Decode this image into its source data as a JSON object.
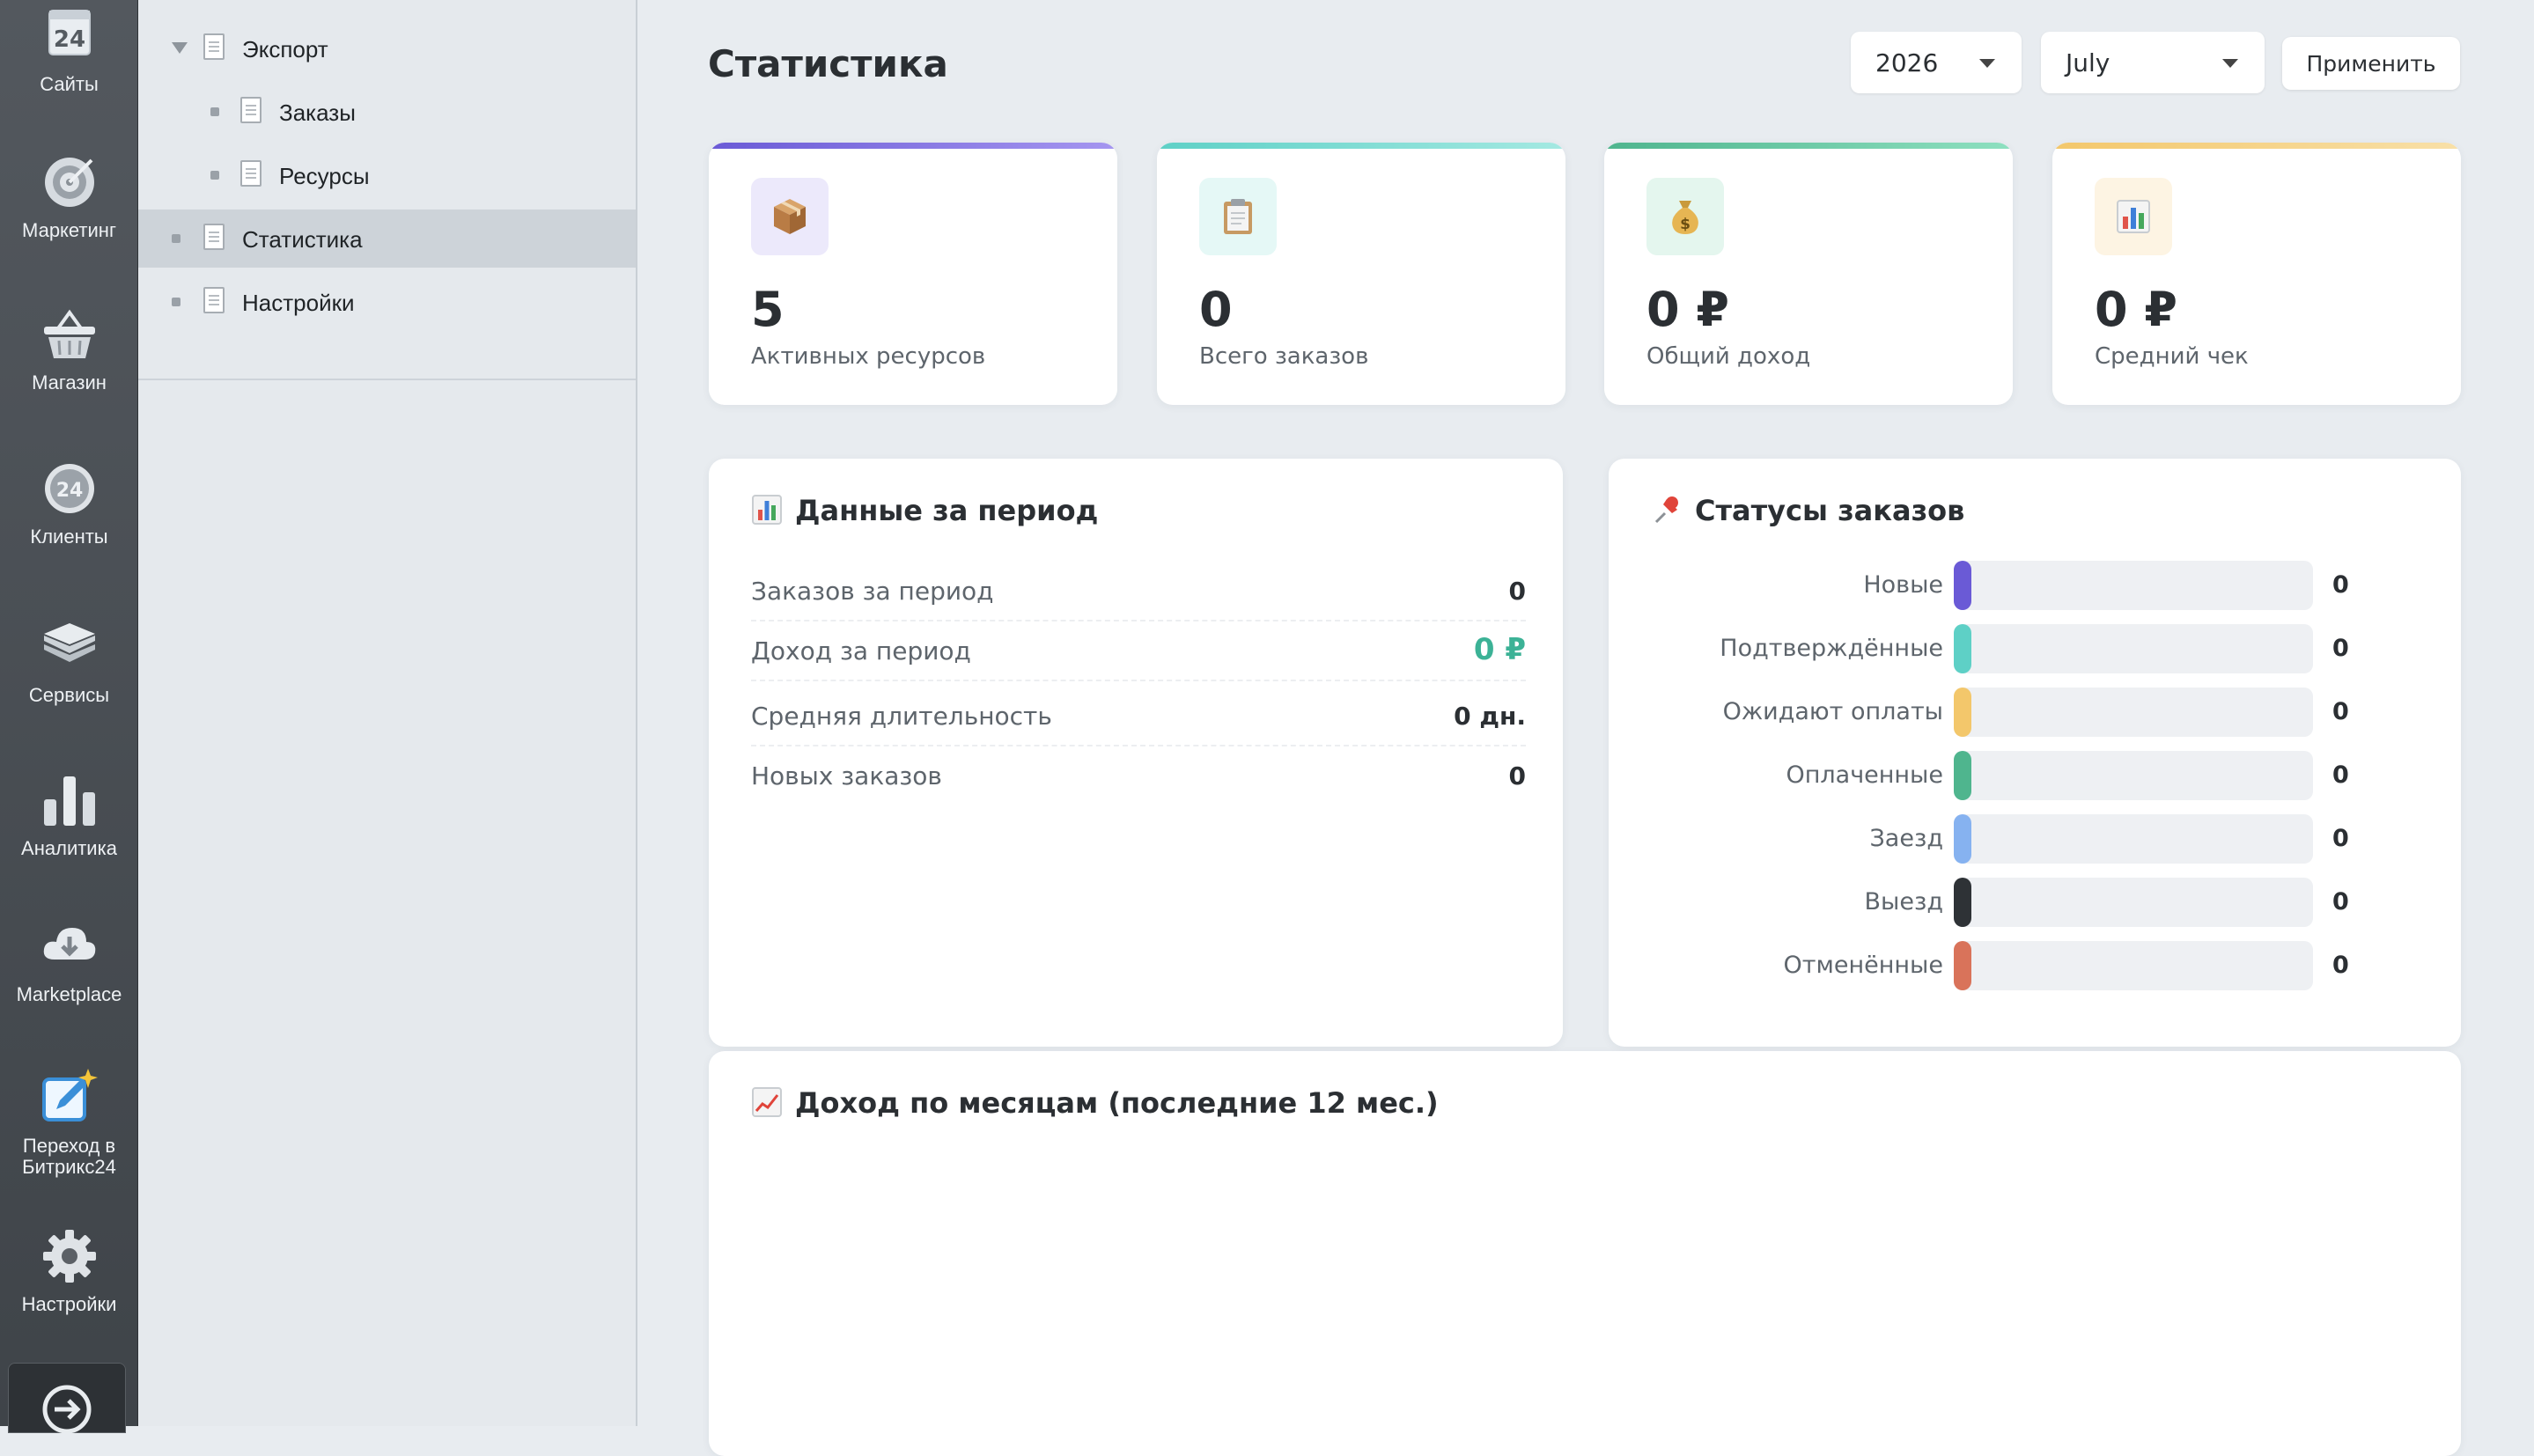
{
  "left_nav": {
    "items": [
      {
        "label": "Сайты",
        "icon": "calendar-24-icon"
      },
      {
        "label": "Маркетинг",
        "icon": "target-icon"
      },
      {
        "label": "Магазин",
        "icon": "basket-icon"
      },
      {
        "label": "Клиенты",
        "icon": "clients-24-icon"
      },
      {
        "label": "Сервисы",
        "icon": "layers-icon"
      },
      {
        "label": "Аналитика",
        "icon": "bar-chart-icon"
      },
      {
        "label": "Marketplace",
        "icon": "cloud-download-icon"
      },
      {
        "label": "Переход в Битрикс24",
        "icon": "edit-sparkle-icon"
      },
      {
        "label": "Настройки",
        "icon": "gear-icon"
      }
    ],
    "exit_icon": "arrow-right-circle-icon"
  },
  "tree": {
    "items": [
      {
        "label": "Экспорт",
        "expanded": true
      },
      {
        "label": "Заказы"
      },
      {
        "label": "Ресурсы"
      },
      {
        "label": "Статистика",
        "active": true
      },
      {
        "label": "Настройки"
      }
    ]
  },
  "header": {
    "title": "Статистика",
    "year": "2026",
    "month": "July",
    "apply": "Применить"
  },
  "stats": [
    {
      "value": "5",
      "label": "Активных ресурсов",
      "icon": "package-icon",
      "accent": "#7b6ae0",
      "icon_bg": "#ece9fb"
    },
    {
      "value": "0",
      "label": "Всего заказов",
      "icon": "clipboard-icon",
      "accent": "#5ed0c6",
      "icon_bg": "#e5f8f6"
    },
    {
      "value": "0 ₽",
      "label": "Общий доход",
      "icon": "money-bag-icon",
      "accent": "#4fbf97",
      "icon_bg": "#e4f6ee"
    },
    {
      "value": "0 ₽",
      "label": "Средний чек",
      "icon": "bar-chart-icon",
      "accent": "#f3c76b",
      "icon_bg": "#fdf4e3"
    }
  ],
  "period": {
    "title": "Данные за период",
    "rows": [
      {
        "label": "Заказов за период",
        "value": "0"
      },
      {
        "label": "Доход за период",
        "value": "0 ₽"
      },
      {
        "label": "Средняя длительность",
        "value": "0 дн."
      },
      {
        "label": "Новых заказов",
        "value": "0"
      }
    ]
  },
  "statuses": {
    "title": "Статусы заказов",
    "rows": [
      {
        "label": "Новые",
        "count": "0",
        "color": "#6a5ad6"
      },
      {
        "label": "Подтверждённые",
        "count": "0",
        "color": "#5ed0c6"
      },
      {
        "label": "Ожидают оплаты",
        "count": "0",
        "color": "#f3c76b"
      },
      {
        "label": "Оплаченные",
        "count": "0",
        "color": "#4fb58e"
      },
      {
        "label": "Заезд",
        "count": "0",
        "color": "#86b2f0"
      },
      {
        "label": "Выезд",
        "count": "0",
        "color": "#2e3236"
      },
      {
        "label": "Отменённые",
        "count": "0",
        "color": "#d9735a"
      }
    ]
  },
  "monthly": {
    "title": "Доход по месяцам (последние 12 мес.)"
  }
}
